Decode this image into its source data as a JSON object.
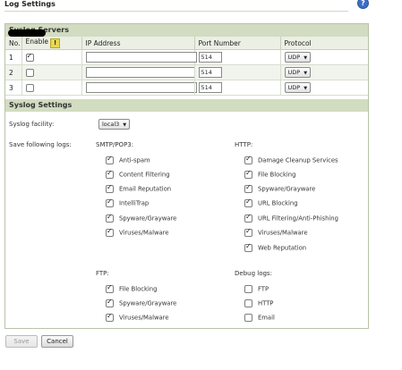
{
  "page": {
    "title": "Log Settings"
  },
  "syslog_servers": {
    "heading": "Syslog Servers",
    "columns": {
      "no": "No.",
      "enable": "Enable",
      "ip": "IP Address",
      "port": "Port Number",
      "protocol": "Protocol"
    },
    "rows": [
      {
        "no": "1",
        "enabled": true,
        "ip": "",
        "port": "514",
        "protocol": "UDP"
      },
      {
        "no": "2",
        "enabled": false,
        "ip": "",
        "port": "514",
        "protocol": "UDP"
      },
      {
        "no": "3",
        "enabled": false,
        "ip": "",
        "port": "514",
        "protocol": "UDP"
      }
    ]
  },
  "syslog_settings": {
    "heading": "Syslog Settings",
    "facility_label": "Syslog facility:",
    "facility_value": "local3",
    "save_logs_label": "Save following logs:",
    "smtp": {
      "label": "SMTP/POP3:",
      "items": [
        {
          "label": "Anti-spam",
          "checked": true
        },
        {
          "label": "Content Filtering",
          "checked": true
        },
        {
          "label": "Email Reputation",
          "checked": true
        },
        {
          "label": "IntelliTrap",
          "checked": true
        },
        {
          "label": "Spyware/Grayware",
          "checked": true
        },
        {
          "label": "Viruses/Malware",
          "checked": true
        }
      ]
    },
    "http": {
      "label": "HTTP:",
      "items": [
        {
          "label": "Damage Cleanup Services",
          "checked": true
        },
        {
          "label": "File Blocking",
          "checked": true
        },
        {
          "label": "Spyware/Grayware",
          "checked": true
        },
        {
          "label": "URL Blocking",
          "checked": true
        },
        {
          "label": "URL Filtering/Anti-Phishing",
          "checked": true
        },
        {
          "label": "Viruses/Malware",
          "checked": true
        },
        {
          "label": "Web Reputation",
          "checked": true
        }
      ]
    },
    "ftp": {
      "label": "FTP:",
      "items": [
        {
          "label": "File Blocking",
          "checked": true
        },
        {
          "label": "Spyware/Grayware",
          "checked": true
        },
        {
          "label": "Viruses/Malware",
          "checked": true
        }
      ]
    },
    "debug": {
      "label": "Debug logs:",
      "items": [
        {
          "label": "FTP",
          "checked": false
        },
        {
          "label": "HTTP",
          "checked": false
        },
        {
          "label": "Email",
          "checked": false
        }
      ]
    }
  },
  "buttons": {
    "save": "Save",
    "cancel": "Cancel"
  },
  "icons": {
    "help": "help-icon",
    "warning": "warning-icon",
    "redaction": "redacted-ip"
  },
  "colors": {
    "section_header": "#d2dcc1",
    "alt_row": "#f1f4ec",
    "help_icon": "#3b6fc4"
  }
}
